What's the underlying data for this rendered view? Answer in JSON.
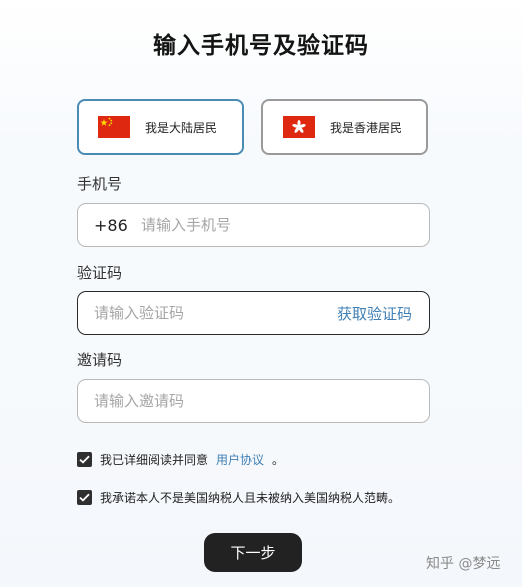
{
  "page": {
    "title": "输入手机号及验证码"
  },
  "residency": {
    "options": [
      {
        "label": "我是大陆居民",
        "flag_icon": "china-flag-icon",
        "selected": true
      },
      {
        "label": "我是香港居民",
        "flag_icon": "hong-kong-flag-icon",
        "selected": false
      }
    ],
    "selected_border_color": "#4a8bb3"
  },
  "phone": {
    "label": "手机号",
    "prefix": "+86",
    "placeholder": "请输入手机号",
    "value": ""
  },
  "code": {
    "label": "验证码",
    "placeholder": "请输入验证码",
    "value": "",
    "action_label": "获取验证码"
  },
  "invite": {
    "label": "邀请码",
    "placeholder": "请输入邀请码",
    "value": ""
  },
  "agreements": [
    {
      "text": "我已详细阅读并同意",
      "link": "用户协议",
      "suffix": "。",
      "checked": true
    },
    {
      "text": "我承诺本人不是美国纳税人且未被纳入美国纳税人范畴。",
      "checked": true
    }
  ],
  "next_button": {
    "label": "下一步"
  },
  "watermark": {
    "text": "知乎 @梦远"
  },
  "colors": {
    "accent_link": "#3f7fb4",
    "button_bg": "#222222",
    "china_red": "#de2910",
    "hk_red": "#de2910"
  }
}
